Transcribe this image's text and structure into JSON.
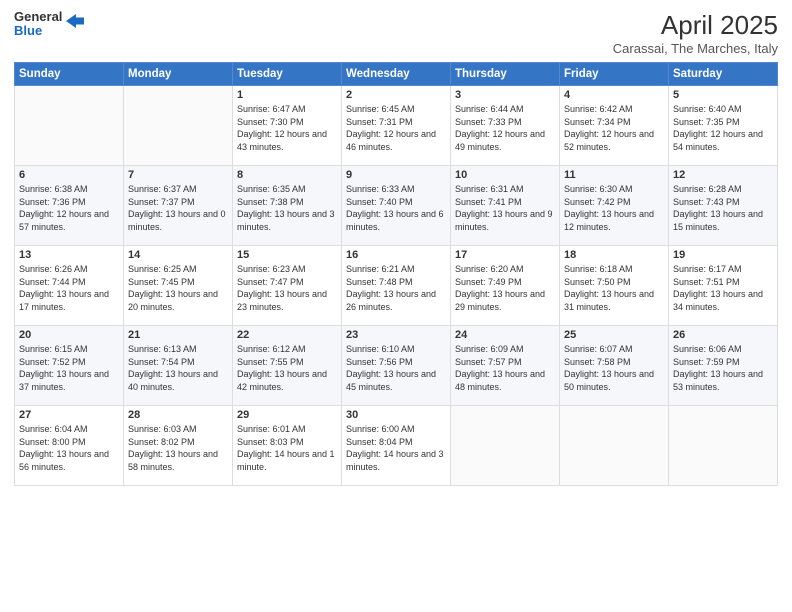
{
  "logo": {
    "line1": "General",
    "line2": "Blue"
  },
  "header": {
    "month_year": "April 2025",
    "location": "Carassai, The Marches, Italy"
  },
  "weekdays": [
    "Sunday",
    "Monday",
    "Tuesday",
    "Wednesday",
    "Thursday",
    "Friday",
    "Saturday"
  ],
  "weeks": [
    [
      {
        "day": "",
        "info": ""
      },
      {
        "day": "",
        "info": ""
      },
      {
        "day": "1",
        "info": "Sunrise: 6:47 AM\nSunset: 7:30 PM\nDaylight: 12 hours and 43 minutes."
      },
      {
        "day": "2",
        "info": "Sunrise: 6:45 AM\nSunset: 7:31 PM\nDaylight: 12 hours and 46 minutes."
      },
      {
        "day": "3",
        "info": "Sunrise: 6:44 AM\nSunset: 7:33 PM\nDaylight: 12 hours and 49 minutes."
      },
      {
        "day": "4",
        "info": "Sunrise: 6:42 AM\nSunset: 7:34 PM\nDaylight: 12 hours and 52 minutes."
      },
      {
        "day": "5",
        "info": "Sunrise: 6:40 AM\nSunset: 7:35 PM\nDaylight: 12 hours and 54 minutes."
      }
    ],
    [
      {
        "day": "6",
        "info": "Sunrise: 6:38 AM\nSunset: 7:36 PM\nDaylight: 12 hours and 57 minutes."
      },
      {
        "day": "7",
        "info": "Sunrise: 6:37 AM\nSunset: 7:37 PM\nDaylight: 13 hours and 0 minutes."
      },
      {
        "day": "8",
        "info": "Sunrise: 6:35 AM\nSunset: 7:38 PM\nDaylight: 13 hours and 3 minutes."
      },
      {
        "day": "9",
        "info": "Sunrise: 6:33 AM\nSunset: 7:40 PM\nDaylight: 13 hours and 6 minutes."
      },
      {
        "day": "10",
        "info": "Sunrise: 6:31 AM\nSunset: 7:41 PM\nDaylight: 13 hours and 9 minutes."
      },
      {
        "day": "11",
        "info": "Sunrise: 6:30 AM\nSunset: 7:42 PM\nDaylight: 13 hours and 12 minutes."
      },
      {
        "day": "12",
        "info": "Sunrise: 6:28 AM\nSunset: 7:43 PM\nDaylight: 13 hours and 15 minutes."
      }
    ],
    [
      {
        "day": "13",
        "info": "Sunrise: 6:26 AM\nSunset: 7:44 PM\nDaylight: 13 hours and 17 minutes."
      },
      {
        "day": "14",
        "info": "Sunrise: 6:25 AM\nSunset: 7:45 PM\nDaylight: 13 hours and 20 minutes."
      },
      {
        "day": "15",
        "info": "Sunrise: 6:23 AM\nSunset: 7:47 PM\nDaylight: 13 hours and 23 minutes."
      },
      {
        "day": "16",
        "info": "Sunrise: 6:21 AM\nSunset: 7:48 PM\nDaylight: 13 hours and 26 minutes."
      },
      {
        "day": "17",
        "info": "Sunrise: 6:20 AM\nSunset: 7:49 PM\nDaylight: 13 hours and 29 minutes."
      },
      {
        "day": "18",
        "info": "Sunrise: 6:18 AM\nSunset: 7:50 PM\nDaylight: 13 hours and 31 minutes."
      },
      {
        "day": "19",
        "info": "Sunrise: 6:17 AM\nSunset: 7:51 PM\nDaylight: 13 hours and 34 minutes."
      }
    ],
    [
      {
        "day": "20",
        "info": "Sunrise: 6:15 AM\nSunset: 7:52 PM\nDaylight: 13 hours and 37 minutes."
      },
      {
        "day": "21",
        "info": "Sunrise: 6:13 AM\nSunset: 7:54 PM\nDaylight: 13 hours and 40 minutes."
      },
      {
        "day": "22",
        "info": "Sunrise: 6:12 AM\nSunset: 7:55 PM\nDaylight: 13 hours and 42 minutes."
      },
      {
        "day": "23",
        "info": "Sunrise: 6:10 AM\nSunset: 7:56 PM\nDaylight: 13 hours and 45 minutes."
      },
      {
        "day": "24",
        "info": "Sunrise: 6:09 AM\nSunset: 7:57 PM\nDaylight: 13 hours and 48 minutes."
      },
      {
        "day": "25",
        "info": "Sunrise: 6:07 AM\nSunset: 7:58 PM\nDaylight: 13 hours and 50 minutes."
      },
      {
        "day": "26",
        "info": "Sunrise: 6:06 AM\nSunset: 7:59 PM\nDaylight: 13 hours and 53 minutes."
      }
    ],
    [
      {
        "day": "27",
        "info": "Sunrise: 6:04 AM\nSunset: 8:00 PM\nDaylight: 13 hours and 56 minutes."
      },
      {
        "day": "28",
        "info": "Sunrise: 6:03 AM\nSunset: 8:02 PM\nDaylight: 13 hours and 58 minutes."
      },
      {
        "day": "29",
        "info": "Sunrise: 6:01 AM\nSunset: 8:03 PM\nDaylight: 14 hours and 1 minute."
      },
      {
        "day": "30",
        "info": "Sunrise: 6:00 AM\nSunset: 8:04 PM\nDaylight: 14 hours and 3 minutes."
      },
      {
        "day": "",
        "info": ""
      },
      {
        "day": "",
        "info": ""
      },
      {
        "day": "",
        "info": ""
      }
    ]
  ]
}
